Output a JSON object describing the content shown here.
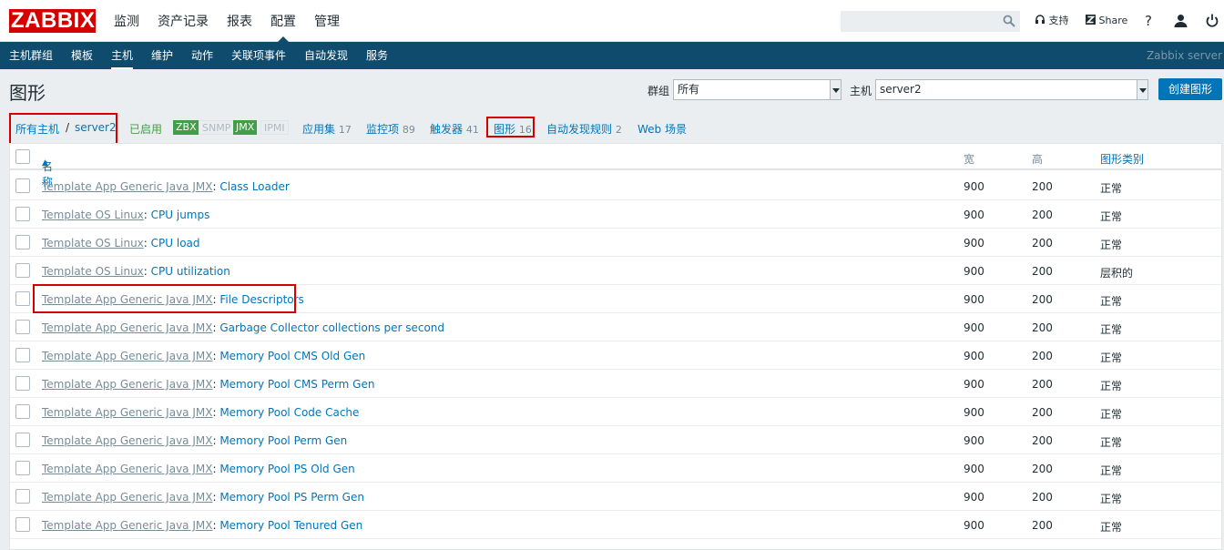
{
  "app": {
    "logo": "ZABBIX"
  },
  "mainmenu": [
    {
      "label": "监测"
    },
    {
      "label": "资产记录"
    },
    {
      "label": "报表"
    },
    {
      "label": "配置"
    },
    {
      "label": "管理"
    }
  ],
  "topright": {
    "support": "支持",
    "share": "Share",
    "help": "?"
  },
  "subnav": {
    "items": [
      {
        "label": "主机群组"
      },
      {
        "label": "模板"
      },
      {
        "label": "主机"
      },
      {
        "label": "维护"
      },
      {
        "label": "动作"
      },
      {
        "label": "关联项事件"
      },
      {
        "label": "自动发现"
      },
      {
        "label": "服务"
      }
    ],
    "server": "Zabbix server"
  },
  "page": {
    "title": "图形",
    "create_button": "创建图形"
  },
  "filter": {
    "group_label": "群组",
    "group_value": "所有",
    "host_label": "主机",
    "host_value": "server2"
  },
  "breadcrumb": {
    "all_hosts": "所有主机",
    "sep": "/",
    "host": "server2"
  },
  "status": {
    "enabled": "已启用",
    "zbx": "ZBX",
    "snmp": "SNMP",
    "jmx": "JMX",
    "ipmi": "IPMI"
  },
  "tabs": {
    "applications": {
      "label": "应用集",
      "count": "17"
    },
    "items": {
      "label": "监控项",
      "count": "89"
    },
    "triggers": {
      "label": "触发器",
      "count": "41"
    },
    "graphs": {
      "label": "图形",
      "count": "16"
    },
    "discovery": {
      "label": "自动发现规则",
      "count": "2"
    },
    "web": {
      "label": "Web 场景"
    }
  },
  "table": {
    "headers": {
      "name": "名称",
      "width": "宽",
      "height": "高",
      "type": "图形类别"
    },
    "rows": [
      {
        "template": "Template App Generic Java JMX",
        "name": "Class Loader",
        "width": "900",
        "height": "200",
        "type": "正常"
      },
      {
        "template": "Template OS Linux",
        "name": "CPU jumps",
        "width": "900",
        "height": "200",
        "type": "正常"
      },
      {
        "template": "Template OS Linux",
        "name": "CPU load",
        "width": "900",
        "height": "200",
        "type": "正常"
      },
      {
        "template": "Template OS Linux",
        "name": "CPU utilization",
        "width": "900",
        "height": "200",
        "type": "层积的"
      },
      {
        "template": "Template App Generic Java JMX",
        "name": "File Descriptors",
        "width": "900",
        "height": "200",
        "type": "正常"
      },
      {
        "template": "Template App Generic Java JMX",
        "name": "Garbage Collector collections per second",
        "width": "900",
        "height": "200",
        "type": "正常"
      },
      {
        "template": "Template App Generic Java JMX",
        "name": "Memory Pool CMS Old Gen",
        "width": "900",
        "height": "200",
        "type": "正常"
      },
      {
        "template": "Template App Generic Java JMX",
        "name": "Memory Pool CMS Perm Gen",
        "width": "900",
        "height": "200",
        "type": "正常"
      },
      {
        "template": "Template App Generic Java JMX",
        "name": "Memory Pool Code Cache",
        "width": "900",
        "height": "200",
        "type": "正常"
      },
      {
        "template": "Template App Generic Java JMX",
        "name": "Memory Pool Perm Gen",
        "width": "900",
        "height": "200",
        "type": "正常"
      },
      {
        "template": "Template App Generic Java JMX",
        "name": "Memory Pool PS Old Gen",
        "width": "900",
        "height": "200",
        "type": "正常"
      },
      {
        "template": "Template App Generic Java JMX",
        "name": "Memory Pool PS Perm Gen",
        "width": "900",
        "height": "200",
        "type": "正常"
      },
      {
        "template": "Template App Generic Java JMX",
        "name": "Memory Pool Tenured Gen",
        "width": "900",
        "height": "200",
        "type": "正常"
      }
    ]
  },
  "colors": {
    "brand": "#d40000",
    "nav": "#0e4b6d",
    "link": "#0275b8",
    "enabled": "#429e47"
  }
}
